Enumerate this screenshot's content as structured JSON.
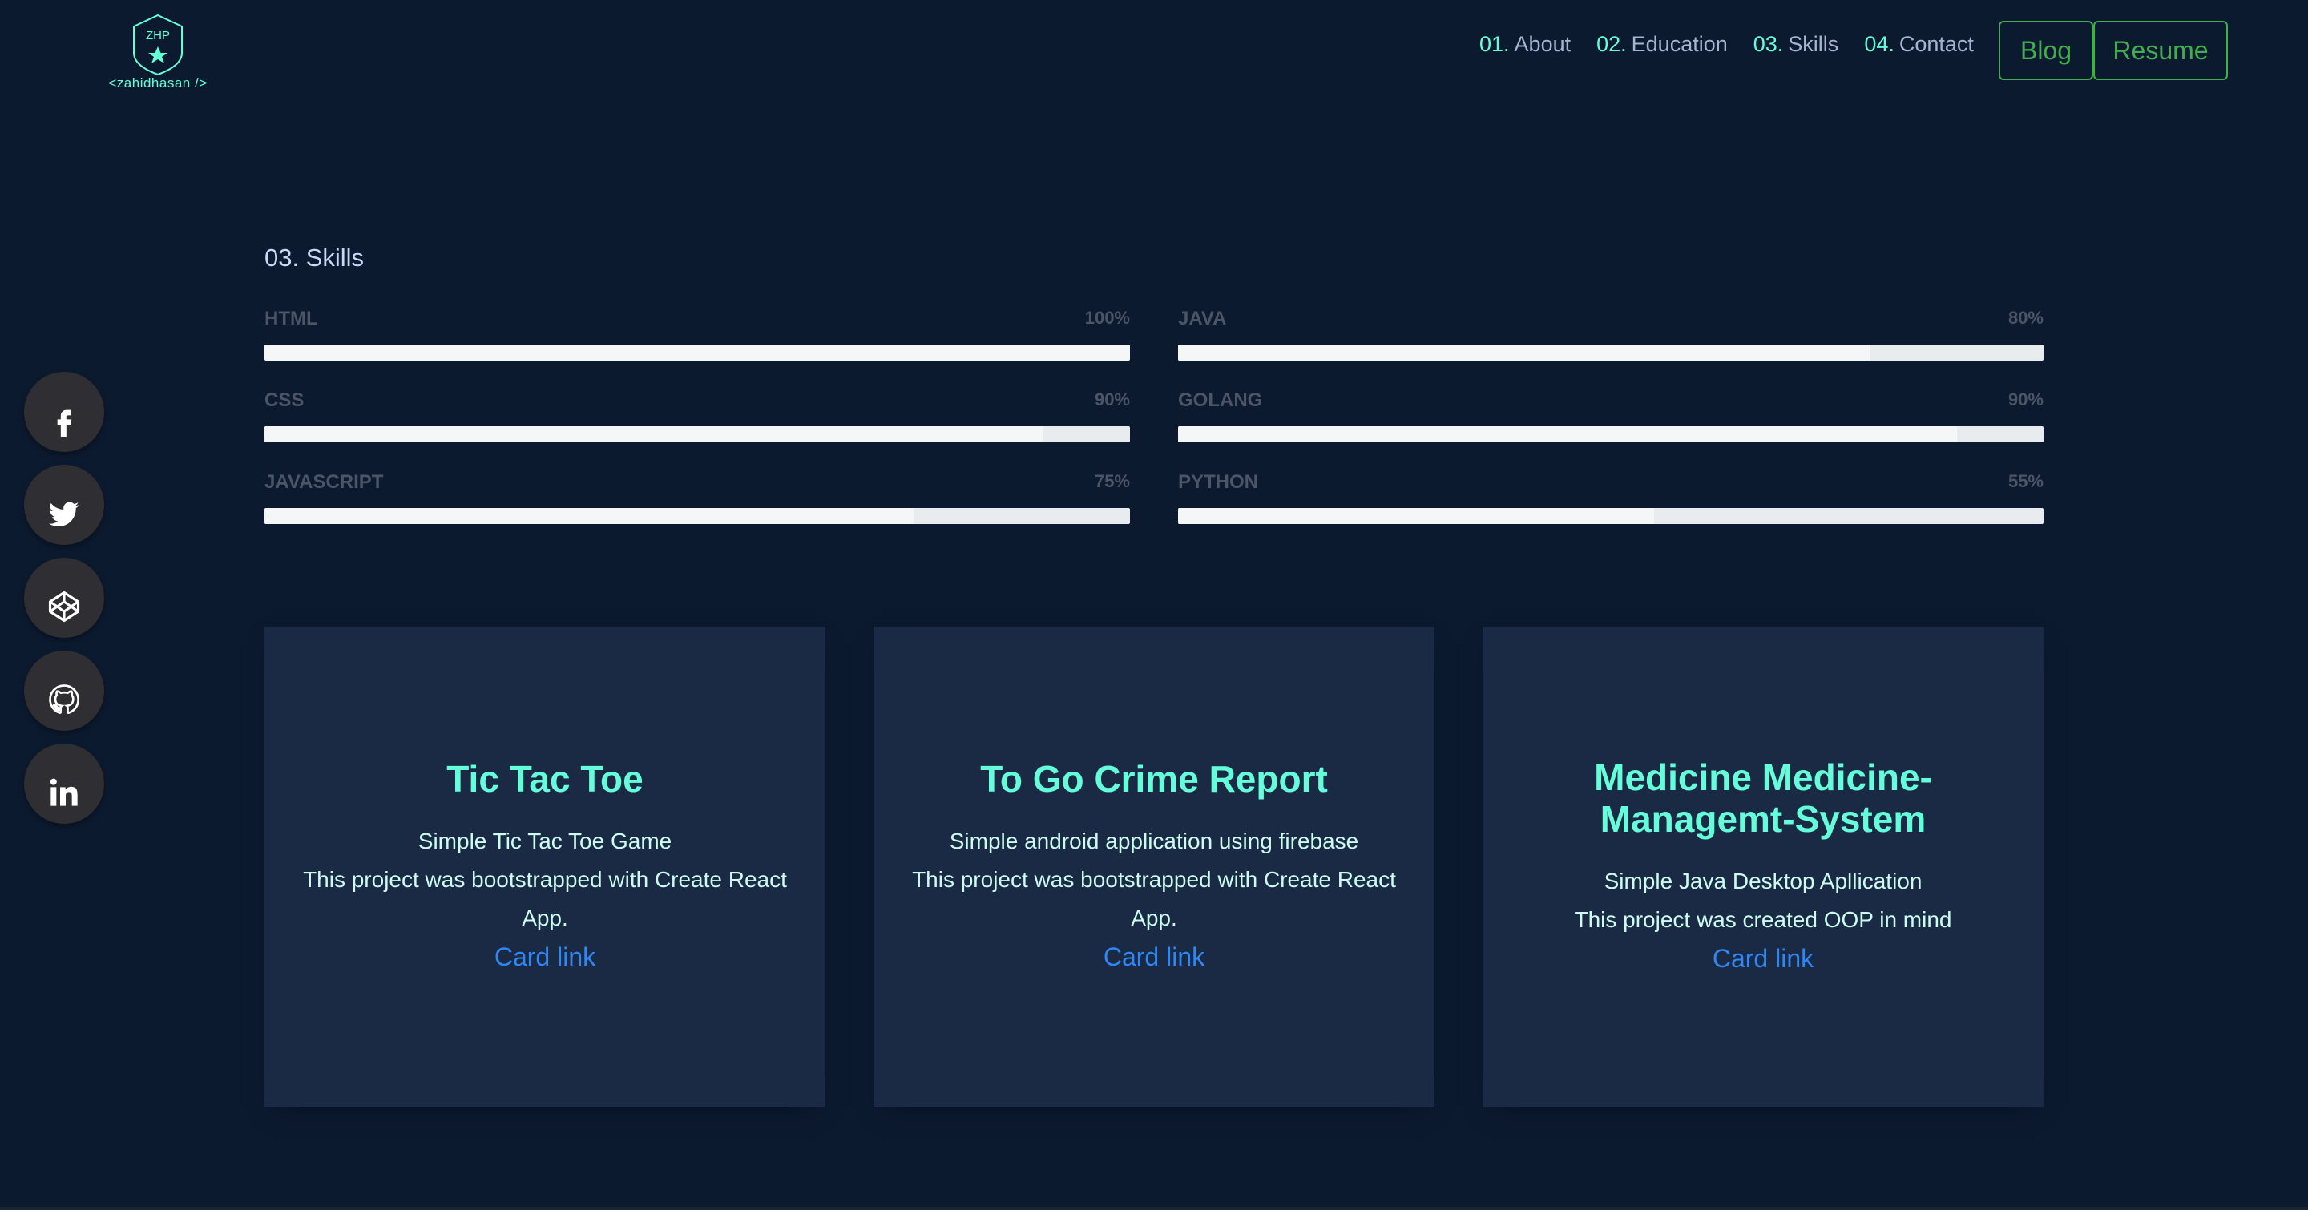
{
  "header": {
    "logo_text": "ZHP",
    "logo_caption": "<zahidhasan />",
    "nav": [
      {
        "num": "01.",
        "label": "About"
      },
      {
        "num": "02.",
        "label": "Education"
      },
      {
        "num": "03.",
        "label": "Skills"
      },
      {
        "num": "04.",
        "label": "Contact"
      }
    ],
    "blog_label": "Blog",
    "resume_label": "Resume"
  },
  "social": [
    "facebook-icon",
    "twitter-icon",
    "codepen-icon",
    "github-icon",
    "linkedin-icon"
  ],
  "skills_section": {
    "title": "03. Skills",
    "skills": [
      {
        "name": "HTML",
        "percent": "100%",
        "value": 100
      },
      {
        "name": "JAVA",
        "percent": "80%",
        "value": 80
      },
      {
        "name": "CSS",
        "percent": "90%",
        "value": 90
      },
      {
        "name": "GOLANG",
        "percent": "90%",
        "value": 90
      },
      {
        "name": "JAVASCRIPT",
        "percent": "75%",
        "value": 75
      },
      {
        "name": "PYTHON",
        "percent": "55%",
        "value": 55
      }
    ]
  },
  "projects": [
    {
      "title": "Tic Tac Toe",
      "line1": "Simple Tic Tac Toe Game",
      "line2": "This project was bootstrapped with Create React App.",
      "link": "Card link"
    },
    {
      "title": "To Go Crime Report",
      "line1": "Simple android application using firebase",
      "line2": "This project was bootstrapped with Create React App.",
      "link": "Card link"
    },
    {
      "title": "Medicine Medicine-Managemt-System",
      "line1": "Simple Java Desktop Apllication",
      "line2": "This project was created OOP in mind",
      "link": "Card link"
    }
  ],
  "colors": {
    "background": "#0c1a30",
    "accent": "#64ffda",
    "button_green": "#3fae4c",
    "link_blue": "#2f87f4",
    "card_bg": "#1a2a45"
  }
}
